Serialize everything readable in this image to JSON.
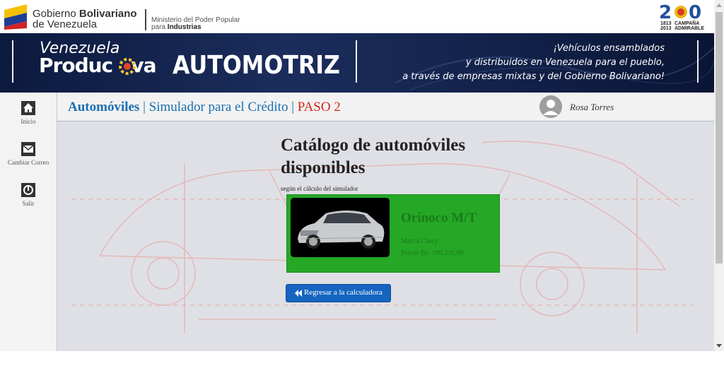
{
  "gov": {
    "line1_prefix": "Gobierno ",
    "line1_bold": "Bolivariano",
    "line2": "de Venezuela",
    "ministry_line1": "Ministerio del Poder Popular",
    "ministry_prefix": "para ",
    "ministry_bold": "Industrias",
    "campaign_years": "1813\n2013",
    "campaign_text": "CAMPAÑA\nADMIRABLE"
  },
  "banner": {
    "venezuela": "Venezuela",
    "productiva": "Produc   va",
    "automotriz": "AUTOMOTRIZ",
    "slogan_1": "¡Vehículos ensamblados",
    "slogan_2": "y distribuidos en Venezuela para el pueblo,",
    "slogan_3": "a través de empresas mixtas y del Gobierno Bolivariano!"
  },
  "sidebar": {
    "items": [
      {
        "label": "Inicio",
        "icon": "home-icon"
      },
      {
        "label": "Cambiar Correo",
        "icon": "mail-icon"
      },
      {
        "label": "Salir",
        "icon": "power-icon"
      }
    ]
  },
  "breadcrumb": {
    "first": "Automóviles",
    "sep1": " | ",
    "second": "Simulador para el Crédito",
    "sep2": " | ",
    "step": "PASO 2"
  },
  "user": {
    "name": "Rosa Torres"
  },
  "main": {
    "title": "Catálogo de automóviles disponibles",
    "subtitle": "según el cálculo del simulador",
    "car": {
      "name": "Orinoco M/T",
      "brand": "Marca Chery",
      "price": "Precio Bs. 196.310,00"
    },
    "back_button": "Regresar a la calculadora"
  },
  "colors": {
    "link_blue": "#1a6fb0",
    "step_red": "#d7261b",
    "card_green": "#25a825",
    "button_blue": "#1565c0"
  }
}
